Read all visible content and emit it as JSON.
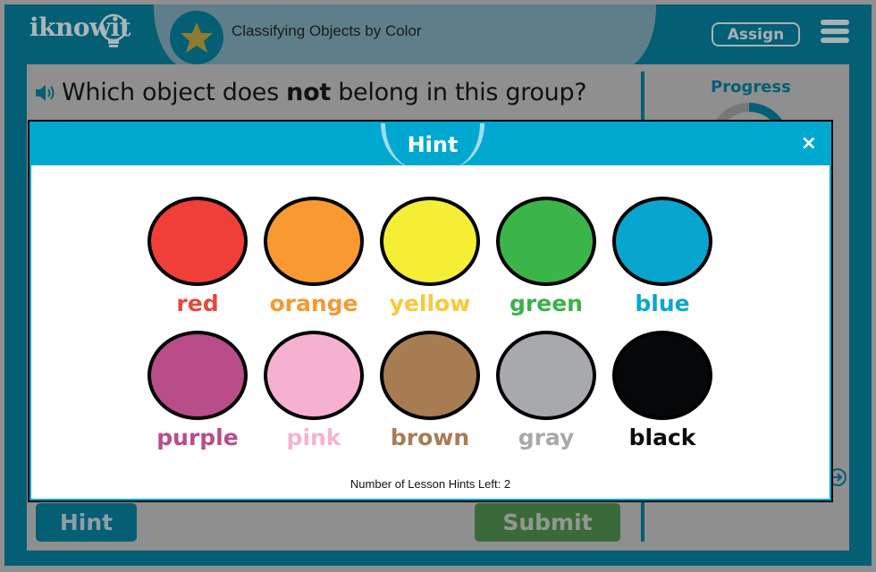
{
  "header": {
    "logo_text": "iknowit",
    "lesson_title": "Classifying Objects by Color",
    "assign_label": "Assign",
    "menu_icon": "hamburger-menu-icon",
    "lesson_icon": "star-icon"
  },
  "question": {
    "prefix": "Which object does ",
    "emphasis": "not",
    "suffix": " belong in this group?",
    "audio_icon": "speaker-icon"
  },
  "sidebar": {
    "progress_label": "Progress",
    "progress_fraction": 0.25,
    "next_icon": "arrow-right-circle-icon"
  },
  "footer": {
    "hint_label": "Hint",
    "submit_label": "Submit"
  },
  "modal": {
    "title": "Hint",
    "close_label": "×",
    "hints_left_text": "Number of Lesson Hints Left: 2",
    "colors": [
      {
        "label": "red",
        "fill": "#ef3f38",
        "text_color": "#e8463e"
      },
      {
        "label": "orange",
        "fill": "#f89a31",
        "text_color": "#f49a31"
      },
      {
        "label": "yellow",
        "fill": "#f6ee34",
        "text_color": "#f9c93a"
      },
      {
        "label": "green",
        "fill": "#3bb44a",
        "text_color": "#38b24a"
      },
      {
        "label": "blue",
        "fill": "#08a6cf",
        "text_color": "#0aa6d0"
      },
      {
        "label": "purple",
        "fill": "#b84d89",
        "text_color": "#b84d89"
      },
      {
        "label": "pink",
        "fill": "#f7b1d0",
        "text_color": "#f6b3d0"
      },
      {
        "label": "brown",
        "fill": "#a87c53",
        "text_color": "#a87c53"
      },
      {
        "label": "gray",
        "fill": "#a8a9ac",
        "text_color": "#a8a9ac"
      },
      {
        "label": "black",
        "fill": "#060708",
        "text_color": "#0b0b0b"
      }
    ]
  }
}
